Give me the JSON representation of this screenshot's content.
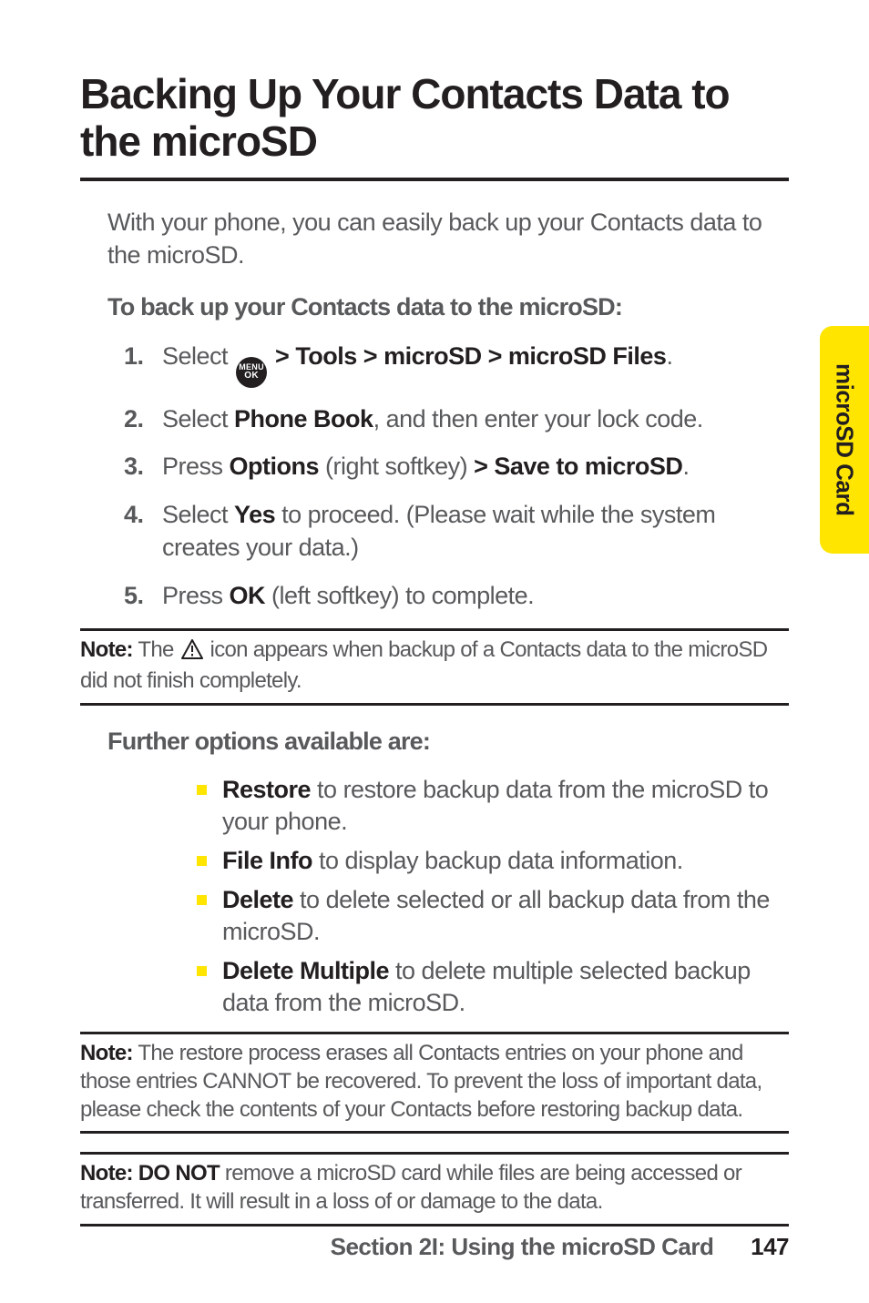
{
  "sideTab": "microSD Card",
  "title": "Backing Up Your Contacts Data to the microSD",
  "intro": "With your phone, you can easily back up your Contacts data to the microSD.",
  "subhead1": "To back up your Contacts data to the microSD:",
  "steps": [
    {
      "n": "1.",
      "pre": "Select ",
      "post": " > Tools > microSD > microSD Files",
      "tail": "."
    },
    {
      "n": "2.",
      "a": "Select ",
      "b": "Phone Book",
      "c": ", and then enter your lock code."
    },
    {
      "n": "3.",
      "a": "Press ",
      "b": "Options",
      "c": " (right softkey) ",
      "d": "> Save to microSD",
      "e": "."
    },
    {
      "n": "4.",
      "a": "Select ",
      "b": "Yes",
      "c": " to proceed. (Please wait while the system creates your data.)"
    },
    {
      "n": "5.",
      "a": "Press ",
      "b": "OK",
      "c": " (left softkey) to complete."
    }
  ],
  "menuIcon": {
    "top": "MENU",
    "bottom": "OK"
  },
  "note1": {
    "label": "Note:",
    "a": " The ",
    "b": " icon appears when backup of a Contacts data to the microSD did not finish completely."
  },
  "subhead2": "Further options available are:",
  "options": [
    {
      "b": "Restore",
      "t": " to restore backup data from the microSD to your phone."
    },
    {
      "b": "File Info",
      "t": " to display backup data information."
    },
    {
      "b": "Delete",
      "t": " to delete selected or all backup data from the microSD."
    },
    {
      "b": "Delete Multiple",
      "t": " to delete multiple selected backup data from the microSD."
    }
  ],
  "note2": {
    "label": "Note:",
    "t": " The restore process erases all Contacts entries on your phone and those entries CANNOT be recovered. To prevent the loss of important data, please check the contents of your Contacts before restoring backup data."
  },
  "note3": {
    "label": "Note:",
    "b": " DO NOT",
    "t": " remove a microSD card while files are being accessed or transferred. It will result in a loss of or damage to the data."
  },
  "footer": {
    "section": "Section 2I: Using the microSD Card",
    "page": "147"
  }
}
